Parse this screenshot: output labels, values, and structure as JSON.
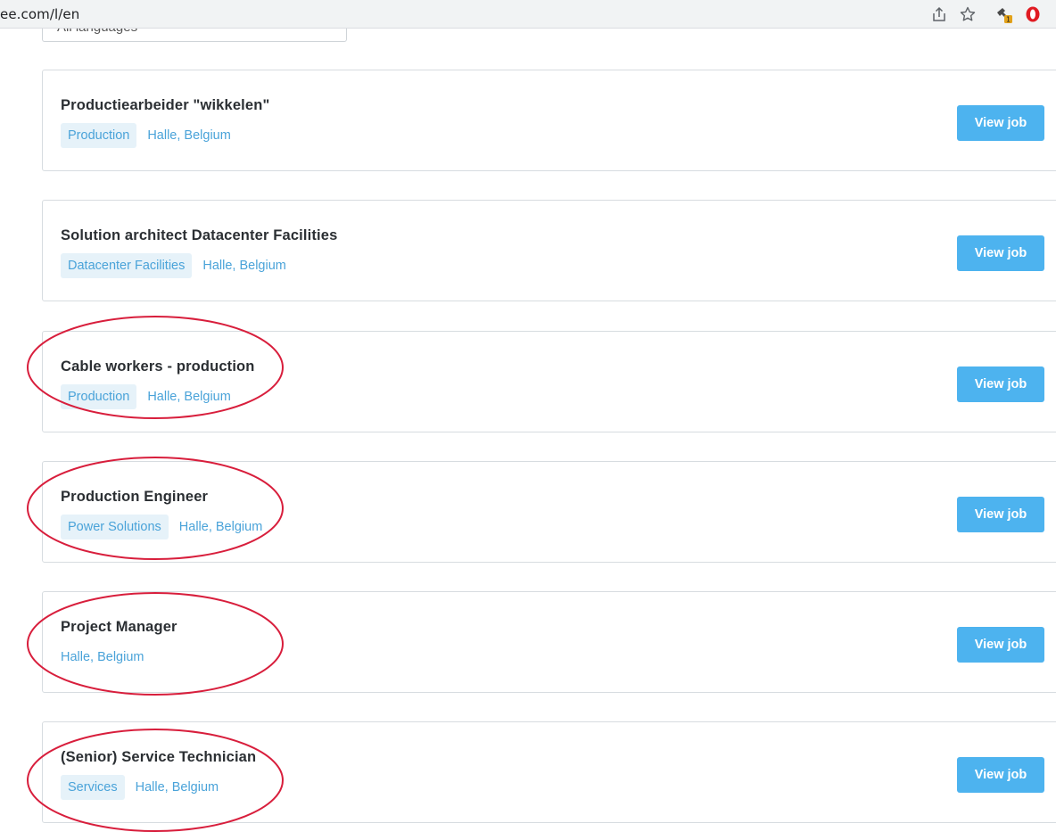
{
  "browser": {
    "url": "ee.com/l/en",
    "icons": [
      "share-icon",
      "bookmark-star-icon",
      "extension-icon",
      "opera-icon"
    ],
    "extension_badge": "1"
  },
  "filter": {
    "language_select_value": "All languages"
  },
  "jobs": [
    {
      "title": "Productiearbeider \"wikkelen\"",
      "tag": "Production",
      "location": "Halle, Belgium",
      "button": "View job",
      "highlighted": false
    },
    {
      "title": "Solution architect Datacenter Facilities",
      "tag": "Datacenter Facilities",
      "location": "Halle, Belgium",
      "button": "View job",
      "highlighted": false
    },
    {
      "title": "Cable workers - production",
      "tag": "Production",
      "location": "Halle, Belgium",
      "button": "View job",
      "highlighted": true
    },
    {
      "title": "Production Engineer",
      "tag": "Power Solutions",
      "location": "Halle, Belgium",
      "button": "View job",
      "highlighted": true
    },
    {
      "title": "Project Manager",
      "tag": "",
      "location": "Halle, Belgium",
      "button": "View job",
      "highlighted": true
    },
    {
      "title": "(Senior) Service Technician",
      "tag": "Services",
      "location": "Halle, Belgium",
      "button": "View job",
      "highlighted": true
    }
  ],
  "colors": {
    "accent": "#4db3ef",
    "tag_bg": "#e6f2f9",
    "link": "#4aa3d9",
    "annotation": "#d81e3c"
  }
}
